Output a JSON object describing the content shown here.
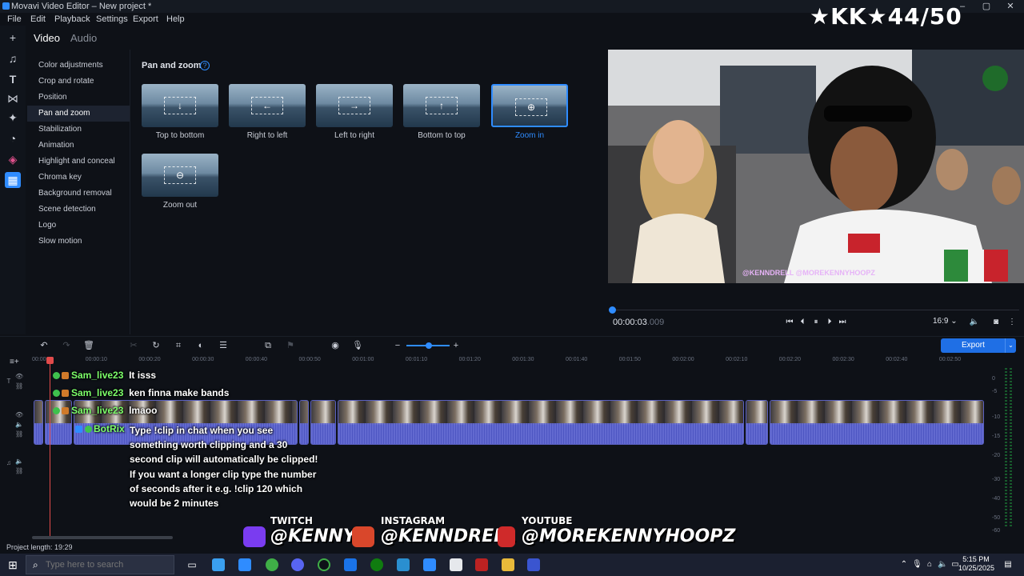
{
  "window": {
    "title": "Movavi Video Editor – New project *",
    "minimize": "–",
    "maximize": "▢",
    "close": "✕"
  },
  "menu": [
    "File",
    "Edit",
    "Playback",
    "Settings",
    "Export",
    "Help"
  ],
  "overlay": {
    "kk_counter": "★KK★44/50"
  },
  "tabs": {
    "video": "Video",
    "audio": "Audio"
  },
  "features": [
    "Color adjustments",
    "Crop and rotate",
    "Position",
    "Pan and zoom",
    "Stabilization",
    "Animation",
    "Highlight and conceal",
    "Chroma key",
    "Background removal",
    "Scene detection",
    "Logo",
    "Slow motion"
  ],
  "active_feature": "Pan and zoom",
  "panel": {
    "title": "Pan and zoom",
    "help": "?",
    "presets": [
      {
        "label": "Top to bottom",
        "glyph": "↓"
      },
      {
        "label": "Right to left",
        "glyph": "←"
      },
      {
        "label": "Left to right",
        "glyph": "→"
      },
      {
        "label": "Bottom to top",
        "glyph": "↑"
      },
      {
        "label": "Zoom in",
        "glyph": "⊕",
        "selected": true
      },
      {
        "label": "Zoom out",
        "glyph": "⊖"
      }
    ]
  },
  "player": {
    "timecode": "00:00:03",
    "timecode_ms": ".009",
    "aspect": "16:9",
    "aspect_caret": "⌄",
    "position": 0.002,
    "stream_tags": "@KENNDRELL  @MOREKENNYHOOPZ"
  },
  "timeline": {
    "ruler": [
      "00:00:00",
      "00:00:10",
      "00:00:20",
      "00:00:30",
      "00:00:40",
      "00:00:50",
      "00:01:00",
      "00:01:10",
      "00:01:20",
      "00:01:30",
      "00:01:40",
      "00:01:50",
      "00:02:00",
      "00:02:10",
      "00:02:20",
      "00:02:30",
      "00:02:40",
      "00:02:50"
    ],
    "meter_labels": [
      "0",
      "-5",
      "-10",
      "-15",
      "-20",
      "-30",
      "-40",
      "-50",
      "-60"
    ],
    "project_length": "Project length: 19:29"
  },
  "export": {
    "label": "Export",
    "caret": "⌄"
  },
  "chat": [
    {
      "user": "Sam_live23",
      "message": "It isss"
    },
    {
      "user": "Sam_live23",
      "message": "ken finna make bands"
    },
    {
      "user": "Sam_live23",
      "message": "lmaoo"
    }
  ],
  "bot": {
    "user": "BotRix",
    "message": "Type !clip in chat when you see something worth clipping and a 30 second clip will automatically be clipped! If you want a longer clip type the number of seconds after it e.g. !clip 120 which would be 2 minutes"
  },
  "socials": [
    {
      "platform": "TWITCH",
      "handle": "@KENNY"
    },
    {
      "platform": "INSTAGRAM",
      "handle": "@KENNDRELL"
    },
    {
      "platform": "YOUTUBE",
      "handle": "@MOREKENNYHOOPZ"
    }
  ],
  "taskbar": {
    "search_placeholder": "Type here to search",
    "time": "5:15 PM",
    "date": "10/25/2025"
  },
  "colors": {
    "accent": "#2f8cff",
    "playhead": "#e24b4b",
    "chat_user": "#7dff6a"
  }
}
